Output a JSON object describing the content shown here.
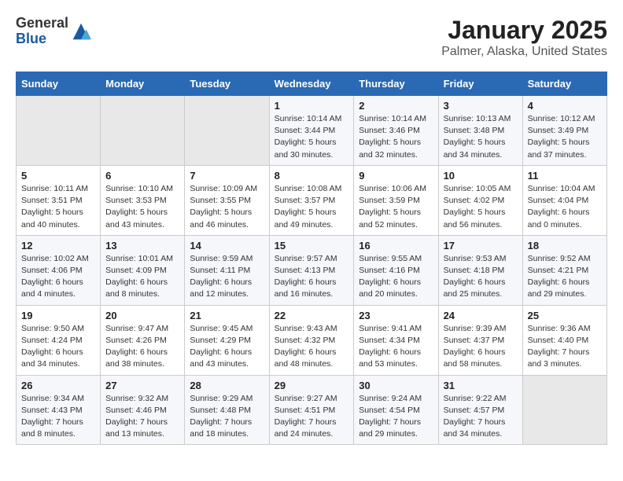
{
  "header": {
    "logo_general": "General",
    "logo_blue": "Blue",
    "title": "January 2025",
    "subtitle": "Palmer, Alaska, United States"
  },
  "calendar": {
    "weekdays": [
      "Sunday",
      "Monday",
      "Tuesday",
      "Wednesday",
      "Thursday",
      "Friday",
      "Saturday"
    ],
    "weeks": [
      [
        {
          "day": "",
          "content": ""
        },
        {
          "day": "",
          "content": ""
        },
        {
          "day": "",
          "content": ""
        },
        {
          "day": "1",
          "content": "Sunrise: 10:14 AM\nSunset: 3:44 PM\nDaylight: 5 hours\nand 30 minutes."
        },
        {
          "day": "2",
          "content": "Sunrise: 10:14 AM\nSunset: 3:46 PM\nDaylight: 5 hours\nand 32 minutes."
        },
        {
          "day": "3",
          "content": "Sunrise: 10:13 AM\nSunset: 3:48 PM\nDaylight: 5 hours\nand 34 minutes."
        },
        {
          "day": "4",
          "content": "Sunrise: 10:12 AM\nSunset: 3:49 PM\nDaylight: 5 hours\nand 37 minutes."
        }
      ],
      [
        {
          "day": "5",
          "content": "Sunrise: 10:11 AM\nSunset: 3:51 PM\nDaylight: 5 hours\nand 40 minutes."
        },
        {
          "day": "6",
          "content": "Sunrise: 10:10 AM\nSunset: 3:53 PM\nDaylight: 5 hours\nand 43 minutes."
        },
        {
          "day": "7",
          "content": "Sunrise: 10:09 AM\nSunset: 3:55 PM\nDaylight: 5 hours\nand 46 minutes."
        },
        {
          "day": "8",
          "content": "Sunrise: 10:08 AM\nSunset: 3:57 PM\nDaylight: 5 hours\nand 49 minutes."
        },
        {
          "day": "9",
          "content": "Sunrise: 10:06 AM\nSunset: 3:59 PM\nDaylight: 5 hours\nand 52 minutes."
        },
        {
          "day": "10",
          "content": "Sunrise: 10:05 AM\nSunset: 4:02 PM\nDaylight: 5 hours\nand 56 minutes."
        },
        {
          "day": "11",
          "content": "Sunrise: 10:04 AM\nSunset: 4:04 PM\nDaylight: 6 hours\nand 0 minutes."
        }
      ],
      [
        {
          "day": "12",
          "content": "Sunrise: 10:02 AM\nSunset: 4:06 PM\nDaylight: 6 hours\nand 4 minutes."
        },
        {
          "day": "13",
          "content": "Sunrise: 10:01 AM\nSunset: 4:09 PM\nDaylight: 6 hours\nand 8 minutes."
        },
        {
          "day": "14",
          "content": "Sunrise: 9:59 AM\nSunset: 4:11 PM\nDaylight: 6 hours\nand 12 minutes."
        },
        {
          "day": "15",
          "content": "Sunrise: 9:57 AM\nSunset: 4:13 PM\nDaylight: 6 hours\nand 16 minutes."
        },
        {
          "day": "16",
          "content": "Sunrise: 9:55 AM\nSunset: 4:16 PM\nDaylight: 6 hours\nand 20 minutes."
        },
        {
          "day": "17",
          "content": "Sunrise: 9:53 AM\nSunset: 4:18 PM\nDaylight: 6 hours\nand 25 minutes."
        },
        {
          "day": "18",
          "content": "Sunrise: 9:52 AM\nSunset: 4:21 PM\nDaylight: 6 hours\nand 29 minutes."
        }
      ],
      [
        {
          "day": "19",
          "content": "Sunrise: 9:50 AM\nSunset: 4:24 PM\nDaylight: 6 hours\nand 34 minutes."
        },
        {
          "day": "20",
          "content": "Sunrise: 9:47 AM\nSunset: 4:26 PM\nDaylight: 6 hours\nand 38 minutes."
        },
        {
          "day": "21",
          "content": "Sunrise: 9:45 AM\nSunset: 4:29 PM\nDaylight: 6 hours\nand 43 minutes."
        },
        {
          "day": "22",
          "content": "Sunrise: 9:43 AM\nSunset: 4:32 PM\nDaylight: 6 hours\nand 48 minutes."
        },
        {
          "day": "23",
          "content": "Sunrise: 9:41 AM\nSunset: 4:34 PM\nDaylight: 6 hours\nand 53 minutes."
        },
        {
          "day": "24",
          "content": "Sunrise: 9:39 AM\nSunset: 4:37 PM\nDaylight: 6 hours\nand 58 minutes."
        },
        {
          "day": "25",
          "content": "Sunrise: 9:36 AM\nSunset: 4:40 PM\nDaylight: 7 hours\nand 3 minutes."
        }
      ],
      [
        {
          "day": "26",
          "content": "Sunrise: 9:34 AM\nSunset: 4:43 PM\nDaylight: 7 hours\nand 8 minutes."
        },
        {
          "day": "27",
          "content": "Sunrise: 9:32 AM\nSunset: 4:46 PM\nDaylight: 7 hours\nand 13 minutes."
        },
        {
          "day": "28",
          "content": "Sunrise: 9:29 AM\nSunset: 4:48 PM\nDaylight: 7 hours\nand 18 minutes."
        },
        {
          "day": "29",
          "content": "Sunrise: 9:27 AM\nSunset: 4:51 PM\nDaylight: 7 hours\nand 24 minutes."
        },
        {
          "day": "30",
          "content": "Sunrise: 9:24 AM\nSunset: 4:54 PM\nDaylight: 7 hours\nand 29 minutes."
        },
        {
          "day": "31",
          "content": "Sunrise: 9:22 AM\nSunset: 4:57 PM\nDaylight: 7 hours\nand 34 minutes."
        },
        {
          "day": "",
          "content": ""
        }
      ]
    ]
  }
}
